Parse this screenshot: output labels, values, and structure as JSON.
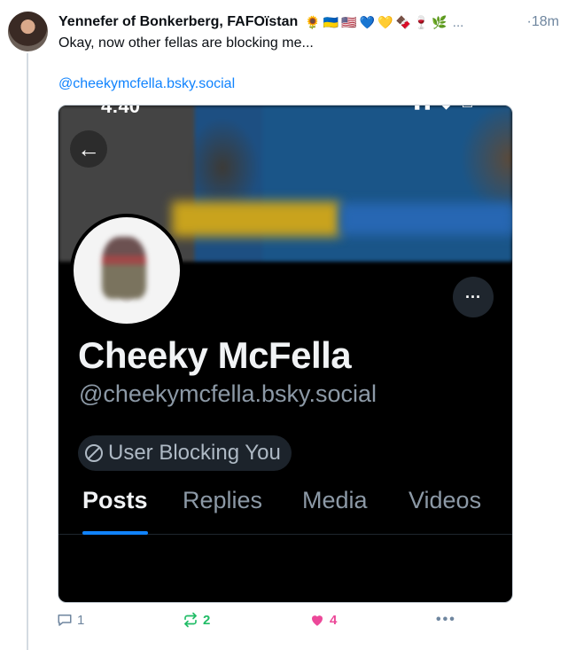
{
  "post": {
    "author": "Yennefer of Bonkerberg, FAFOïstan",
    "emojis": [
      "🌻",
      "🇺🇦",
      "🇺🇸",
      "💙",
      "💛",
      "🍫",
      "🍷",
      "🌿"
    ],
    "truncation": "...",
    "time_prefix": "·",
    "time": "18m",
    "text": "Okay, now other fellas are blocking me...",
    "link": "@cheekymcfella.bsky.social"
  },
  "screenshot": {
    "clock": "4:40",
    "back_icon": "arrow-left-icon",
    "more_icon": "ellipsis-icon",
    "display_name": "Cheeky McFella",
    "handle": "@cheekymcfella.bsky.social",
    "block_label": "User Blocking You",
    "tabs": [
      {
        "label": "Posts",
        "active": true
      },
      {
        "label": "Replies",
        "active": false
      },
      {
        "label": "Media",
        "active": false
      },
      {
        "label": "Videos",
        "active": false
      }
    ]
  },
  "actions": {
    "replies": "1",
    "reposts": "2",
    "likes": "4"
  },
  "colors": {
    "link": "#1083fe",
    "repost": "#20bc66",
    "like": "#ec4899",
    "muted": "#6f869f"
  }
}
